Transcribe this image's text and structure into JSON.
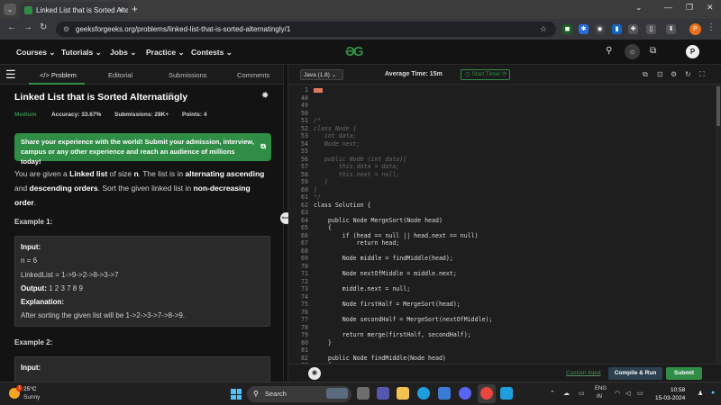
{
  "browser": {
    "tab_title": "Linked List that is Sorted Alternat",
    "tab_close": "×",
    "new_tab": "+",
    "url": "geeksforgeeks.org/problems/linked-list-that-is-sorted-alternatingly/1",
    "window_controls": [
      "⌄",
      "—",
      "❐",
      "✕"
    ]
  },
  "nav": {
    "items": [
      "Courses ⌄",
      "Tutorials ⌄",
      "Jobs ⌄",
      "Practice ⌄",
      "Contests ⌄"
    ],
    "avatar": "P"
  },
  "problem": {
    "tabs": [
      "</> Problem",
      "Editorial",
      "Submissions",
      "Comments"
    ],
    "title": "Linked List that is Sorted Alternatingly",
    "difficulty": "Medium",
    "accuracy": "Accuracy: 33.67%",
    "submissions": "Submissions: 28K+",
    "points": "Points: 4",
    "banner": "Share your experience with the world! Submit your admission, interview, campus or any other experience and reach an audience of millions today!",
    "desc_parts": [
      "You are given a ",
      "Linked list",
      " of size ",
      "n",
      ". The list is in ",
      "alternating ascending",
      " and ",
      "descending orders",
      ". Sort the given linked list in ",
      "non-decreasing order",
      "."
    ],
    "example1_label": "Example 1:",
    "example1": {
      "input_label": "Input:",
      "n_line": "n = 6",
      "list_line": "LinkedList = 1->9->2->8->3->7",
      "output_label": "Output:",
      "output_value": " 1  2  3  7  8  9",
      "expl_label": "Explanation:",
      "expl": "After sorting the given list will be 1->2->3->7->8->9."
    },
    "example2_label": "Example 2:",
    "example2_input_label": "Input:"
  },
  "editor": {
    "language": "Java (1.8)      ⌄",
    "avg_time": "Average Time: 15m",
    "start_timer": "◷ Start Timer ⟳",
    "lines": [
      {
        "n": "1",
        "t": "",
        "c": "hl"
      },
      {
        "n": "48",
        "t": ""
      },
      {
        "n": "49",
        "t": ""
      },
      {
        "n": "50",
        "t": ""
      },
      {
        "n": "51",
        "t": "/*",
        "c": "cm"
      },
      {
        "n": "52",
        "t": "class Node {",
        "c": "cm"
      },
      {
        "n": "53",
        "t": "   int data;",
        "c": "cm"
      },
      {
        "n": "54",
        "t": "   Node next;",
        "c": "cm"
      },
      {
        "n": "55",
        "t": "",
        "c": "cm"
      },
      {
        "n": "56",
        "t": "   public Node (int data){",
        "c": "cm"
      },
      {
        "n": "57",
        "t": "       this.data = data;",
        "c": "cm"
      },
      {
        "n": "58",
        "t": "       this.next = null;",
        "c": "cm"
      },
      {
        "n": "59",
        "t": "   }",
        "c": "cm"
      },
      {
        "n": "60",
        "t": "}",
        "c": "cm"
      },
      {
        "n": "61",
        "t": "*/",
        "c": "cm"
      },
      {
        "n": "62",
        "t": "class Solution {"
      },
      {
        "n": "63",
        "t": ""
      },
      {
        "n": "64",
        "t": "    public Node MergeSort(Node head)"
      },
      {
        "n": "65",
        "t": "    {"
      },
      {
        "n": "66",
        "t": "        if (head == null || head.next == null)"
      },
      {
        "n": "67",
        "t": "            return head;"
      },
      {
        "n": "68",
        "t": ""
      },
      {
        "n": "69",
        "t": "        Node middle = findMiddle(head);"
      },
      {
        "n": "70",
        "t": ""
      },
      {
        "n": "71",
        "t": "        Node nextOfMiddle = middle.next;"
      },
      {
        "n": "72",
        "t": ""
      },
      {
        "n": "73",
        "t": "        middle.next = null;"
      },
      {
        "n": "74",
        "t": ""
      },
      {
        "n": "75",
        "t": "        Node firstHalf = MergeSort(head);"
      },
      {
        "n": "76",
        "t": ""
      },
      {
        "n": "77",
        "t": "        Node secondHalf = MergeSort(nextOfMiddle);"
      },
      {
        "n": "78",
        "t": ""
      },
      {
        "n": "79",
        "t": "        return merge(firstHalf, secondHalf);"
      },
      {
        "n": "80",
        "t": "    }"
      },
      {
        "n": "81",
        "t": ""
      },
      {
        "n": "82",
        "t": "    public Node findMiddle(Node head)"
      },
      {
        "n": "83",
        "t": "    {"
      }
    ],
    "custom_input": "Custom Input",
    "compile_run": "Compile & Run",
    "submit": "Submit"
  },
  "taskbar": {
    "temp": "25°C",
    "weather": "Sunny",
    "weather_badge": "1",
    "search": "Search",
    "lang1": "ENG",
    "lang2": "IN",
    "time": "10:58",
    "date": "15-03-2024"
  },
  "colors": {
    "gfg_green": "#2f8d46",
    "background": "#131313",
    "editor_bg": "#1e1e1e"
  }
}
